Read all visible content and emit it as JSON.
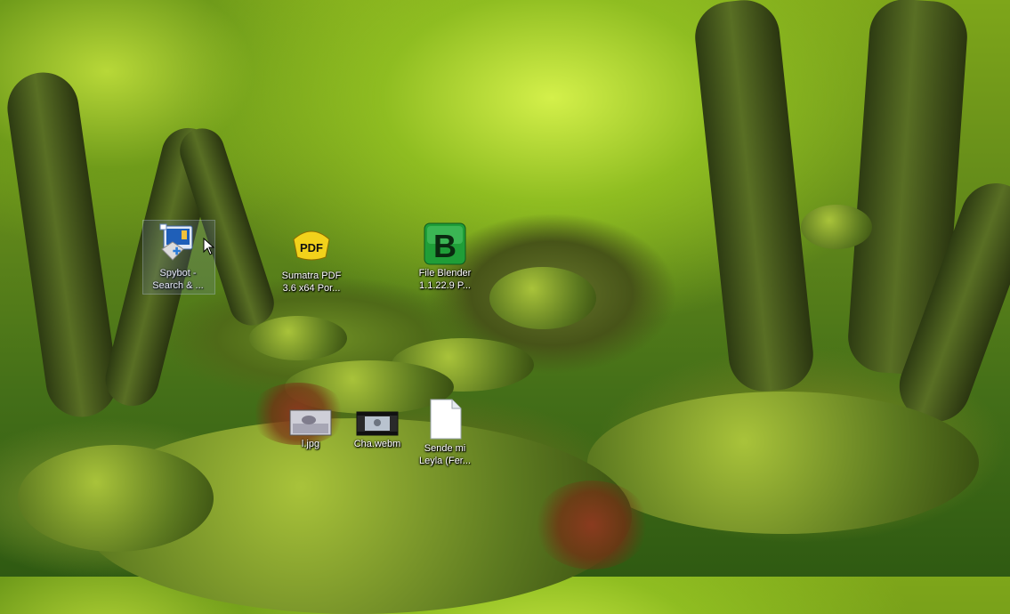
{
  "desktop": {
    "icons": [
      {
        "label": "Spybot -\nSearch & ...",
        "icon": "spybot-icon"
      },
      {
        "label": "Sumatra PDF\n3.6 x64 Por...",
        "icon": "pdf-icon"
      },
      {
        "label": "File Blender\n1.1.22.9 P...",
        "icon": "file-blender-icon"
      },
      {
        "label": "l.jpg",
        "icon": "image-thumbnail-icon"
      },
      {
        "label": "Cha.webm",
        "icon": "video-thumbnail-icon"
      },
      {
        "label": "Sende mi\nLeyla (Fer...",
        "icon": "document-icon"
      }
    ],
    "sumatra_badge": "PDF",
    "blender_letter": "B",
    "colors": {
      "sumatra": "#f2d21b",
      "blender": "#1f9e38",
      "spybot": "#1f5fb8"
    }
  }
}
